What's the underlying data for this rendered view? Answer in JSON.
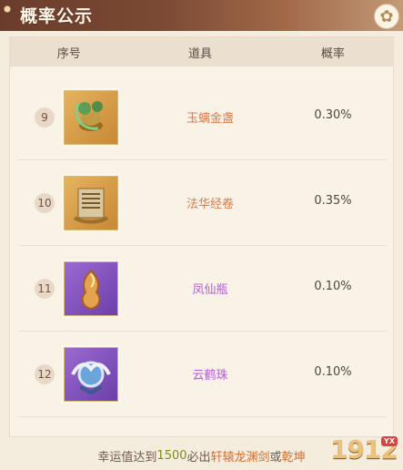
{
  "window": {
    "title": "概率公示"
  },
  "table": {
    "headers": {
      "seq": "序号",
      "item": "道具",
      "rate": "概率"
    },
    "rows": [
      {
        "seq": "9",
        "name": "玉螭金盏",
        "rate": "0.30%",
        "name_color": "#e07a45",
        "icon": "jade-cup-icon"
      },
      {
        "seq": "10",
        "name": "法华经卷",
        "rate": "0.35%",
        "name_color": "#e07a45",
        "icon": "scroll-icon"
      },
      {
        "seq": "11",
        "name": "凤仙瓶",
        "rate": "0.10%",
        "name_color": "#b45ad8",
        "icon": "phoenix-vase-icon"
      },
      {
        "seq": "12",
        "name": "云鹤珠",
        "rate": "0.10%",
        "name_color": "#b45ad8",
        "icon": "crane-pearl-icon"
      }
    ]
  },
  "footer": {
    "prefix": "幸运值达到",
    "value": "1500",
    "middle": "必出",
    "item_a": "轩辕龙渊剑",
    "or": "或",
    "item_b": "乾坤"
  },
  "watermark": {
    "text": "1912",
    "tag": "YX"
  }
}
